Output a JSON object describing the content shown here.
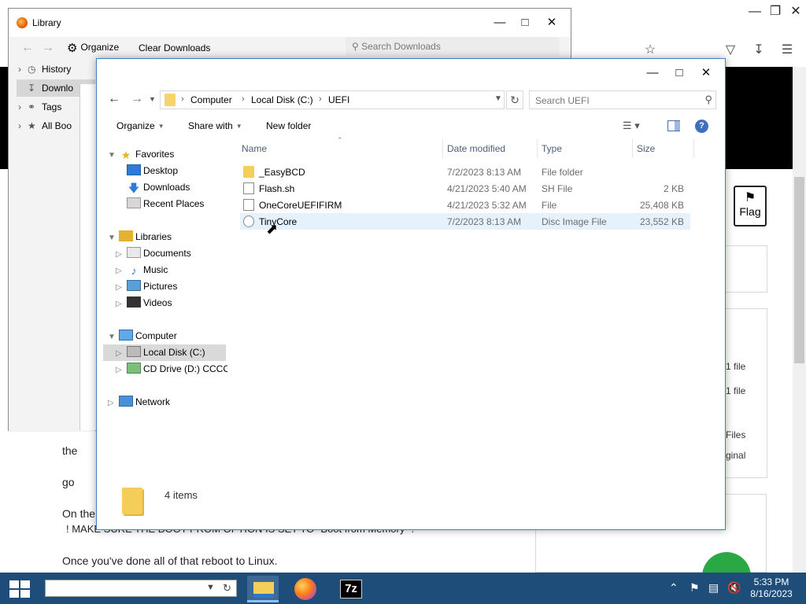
{
  "background_browser": {
    "text_lines": [
      "the",
      "go",
      "On the",
      "! MAKE SURE THE BOOT PROM OPTION IS SET TO \"Boot from Memory\" !",
      "Once you've done all of that reboot to Linux."
    ],
    "flag_label": "Flag",
    "side_texts": [
      "1 file",
      "1 file",
      "Files",
      "ginal"
    ]
  },
  "library": {
    "title": "Library",
    "organize_label": "Organize",
    "clear_downloads_label": "Clear Downloads",
    "search_placeholder": "Search Downloads",
    "tree": [
      {
        "label": "History",
        "icon": "clock-icon"
      },
      {
        "label": "Downlo",
        "icon": "download-icon"
      },
      {
        "label": "Tags",
        "icon": "tag-icon"
      },
      {
        "label": "All Boo",
        "icon": "star-icon"
      }
    ]
  },
  "explorer": {
    "address": {
      "crumbs": [
        "Computer",
        "Local Disk (C:)",
        "UEFI"
      ]
    },
    "search_placeholder": "Search UEFI",
    "commands": {
      "organize": "Organize",
      "share_with": "Share with",
      "new_folder": "New folder"
    },
    "nav_tree": {
      "favorites": "Favorites",
      "desktop": "Desktop",
      "downloads": "Downloads",
      "recent_places": "Recent Places",
      "libraries": "Libraries",
      "documents": "Documents",
      "music": "Music",
      "pictures": "Pictures",
      "videos": "Videos",
      "computer": "Computer",
      "local_disk": "Local Disk (C:)",
      "cd_drive": "CD Drive (D:) CCCOI",
      "network": "Network"
    },
    "columns": {
      "name": "Name",
      "date_modified": "Date modified",
      "type": "Type",
      "size": "Size"
    },
    "files": [
      {
        "name": "_EasyBCD",
        "date": "7/2/2023 8:13 AM",
        "type": "File folder",
        "size": "",
        "icon": "folder-icon"
      },
      {
        "name": "Flash.sh",
        "date": "4/21/2023 5:40 AM",
        "type": "SH File",
        "size": "2 KB",
        "icon": "file-icon"
      },
      {
        "name": "OneCoreUEFIFIRM",
        "date": "4/21/2023 5:32 AM",
        "type": "File",
        "size": "25,408 KB",
        "icon": "file-icon"
      },
      {
        "name": "TinyCore",
        "date": "7/2/2023 8:13 AM",
        "type": "Disc Image File",
        "size": "23,552 KB",
        "icon": "disc-image-icon"
      }
    ],
    "item_count": "4 items"
  },
  "taskbar": {
    "time": "5:33 PM",
    "date": "8/16/2023",
    "apps": [
      "file-explorer",
      "firefox",
      "7-zip"
    ]
  },
  "colors": {
    "taskbar": "#1f4d7a",
    "selection": "#e5f1fb",
    "accent": "#3c82c8"
  }
}
